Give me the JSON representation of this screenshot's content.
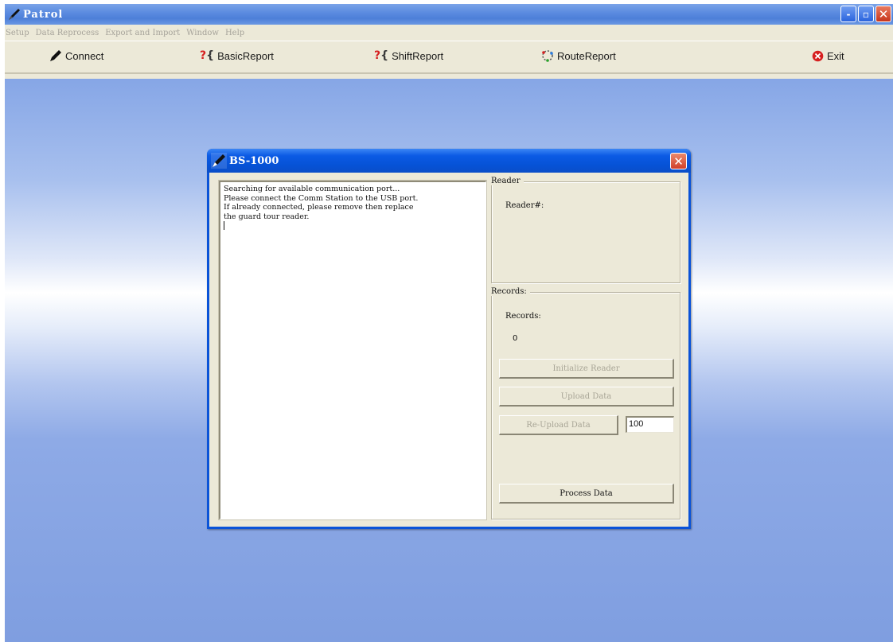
{
  "app": {
    "title": "Patrol",
    "window_controls": {
      "minimize": "-",
      "restore": "▫",
      "close": "✕"
    }
  },
  "menu": [
    "Setup",
    "Data Reprocess",
    "Export and Import",
    "Window",
    "Help"
  ],
  "toolbar": {
    "connect": "Connect",
    "basic_report": "BasicReport",
    "shift_report": "ShiftReport",
    "route_report": "RouteReport",
    "exit": "Exit"
  },
  "dialog": {
    "title": "BS-1000",
    "log_text": "Searching for available communication port...\nPlease connect the Comm Station to the USB port.\nIf already connected, please remove then replace\nthe guard tour reader.\n",
    "reader_group": {
      "label": "Reader",
      "reader_no_label": "Reader#:"
    },
    "records_group": {
      "label": "Records:",
      "records_label": "Records:",
      "records_value": "0"
    },
    "buttons": {
      "initialize": "Initialize Reader",
      "upload": "Upload Data",
      "reupload": "Re-Upload Data",
      "process": "Process Data"
    },
    "reupload_count": "100"
  },
  "colors": {
    "window_face": "#ece9d8",
    "title_blue": "#0a53d8",
    "close_red": "#d1402a",
    "desktop_blue": "#86a6e6"
  }
}
